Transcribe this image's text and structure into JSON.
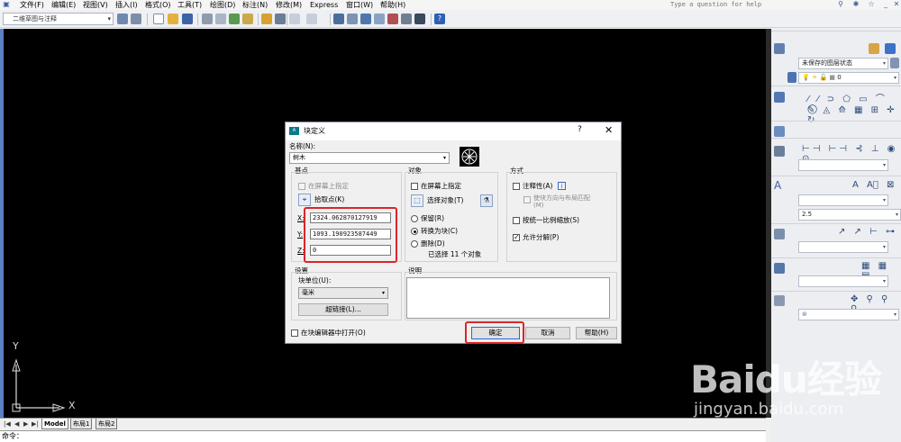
{
  "menu": {
    "items": [
      "文件(F)",
      "编辑(E)",
      "视图(V)",
      "插入(I)",
      "格式(O)",
      "工具(T)",
      "绘图(D)",
      "标注(N)",
      "修改(M)",
      "Express",
      "窗口(W)",
      "帮助(H)"
    ],
    "help_placeholder": "Type a question for help"
  },
  "toolbar": {
    "workspace": "二维草图与注释"
  },
  "panel": {
    "layer_state": "未保存的图层状态",
    "layer_value": "0",
    "text_height": "2.5"
  },
  "tabs": {
    "model": "Model",
    "layout1": "布局1",
    "layout2": "布局2"
  },
  "cmdline": {
    "text": "命令："
  },
  "axes": {
    "x": "X",
    "y": "Y"
  },
  "dialog": {
    "title": "块定义",
    "help": "?",
    "close": "✕",
    "name_label": "名称(N):",
    "name_value": "树木",
    "base_point": {
      "title": "基点",
      "on_screen": "在屏幕上指定",
      "pick_button": "拾取点(K)",
      "x_label": "X:",
      "x_value": "2324.062870127919",
      "y_label": "Y:",
      "y_value": "1093.190923587449",
      "z_label": "Z:",
      "z_value": "0"
    },
    "objects": {
      "title": "对象",
      "on_screen": "在屏幕上指定",
      "select_button": "选择对象(T)",
      "retain": "保留(R)",
      "convert": "转换为块(C)",
      "delete": "删除(D)",
      "selected_text": "已选择 11 个对象"
    },
    "behavior": {
      "title": "方式",
      "annotative": "注释性(A)",
      "match_orientation": "使块方向与布局匹配(M)",
      "scale_uniformly": "按统一比例缩放(S)",
      "allow_exploding": "允许分解(P)"
    },
    "settings": {
      "title": "设置",
      "unit_label": "块单位(U):",
      "unit_value": "毫米",
      "hyperlink_button": "超链接(L)..."
    },
    "description": {
      "title": "说明"
    },
    "open_in_editor": "在块编辑器中打开(O)",
    "ok": "确定",
    "cancel": "取消",
    "help_button": "帮助(H)"
  },
  "watermark": {
    "logo": "Baidu经验",
    "url": "jingyan.baidu.com"
  },
  "colors": {
    "highlight": "#d8262b",
    "canvas": "#000000"
  }
}
